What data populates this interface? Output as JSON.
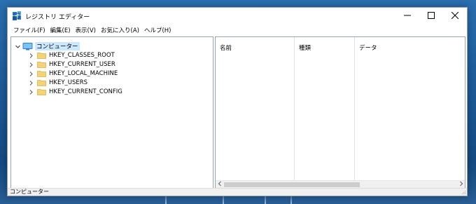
{
  "window": {
    "title": "レジストリ エディター",
    "icon": "registry-editor-icon"
  },
  "titlebar_buttons": {
    "minimize": "minimize-icon",
    "maximize": "maximize-icon",
    "close": "close-icon"
  },
  "menu": [
    {
      "label": "ファイル(F)"
    },
    {
      "label": "編集(E)"
    },
    {
      "label": "表示(V)"
    },
    {
      "label": "お気に入り(A)"
    },
    {
      "label": "ヘルプ(H)"
    }
  ],
  "tree": {
    "root": {
      "label": "コンピューター",
      "icon": "computer-icon",
      "expanded": true,
      "selected": true
    },
    "children": [
      {
        "label": "HKEY_CLASSES_ROOT",
        "icon": "folder-icon"
      },
      {
        "label": "HKEY_CURRENT_USER",
        "icon": "folder-icon"
      },
      {
        "label": "HKEY_LOCAL_MACHINE",
        "icon": "folder-icon"
      },
      {
        "label": "HKEY_USERS",
        "icon": "folder-icon"
      },
      {
        "label": "HKEY_CURRENT_CONFIG",
        "icon": "folder-icon"
      }
    ]
  },
  "list": {
    "columns": [
      {
        "label": "名前"
      },
      {
        "label": "種類"
      },
      {
        "label": "データ"
      }
    ],
    "rows": []
  },
  "statusbar": {
    "path": "コンピューター"
  },
  "colors": {
    "selection": "#cce8ff",
    "folder": "#f3d27a",
    "border": "#9aa3ad",
    "accent": "#2f7fd1"
  }
}
